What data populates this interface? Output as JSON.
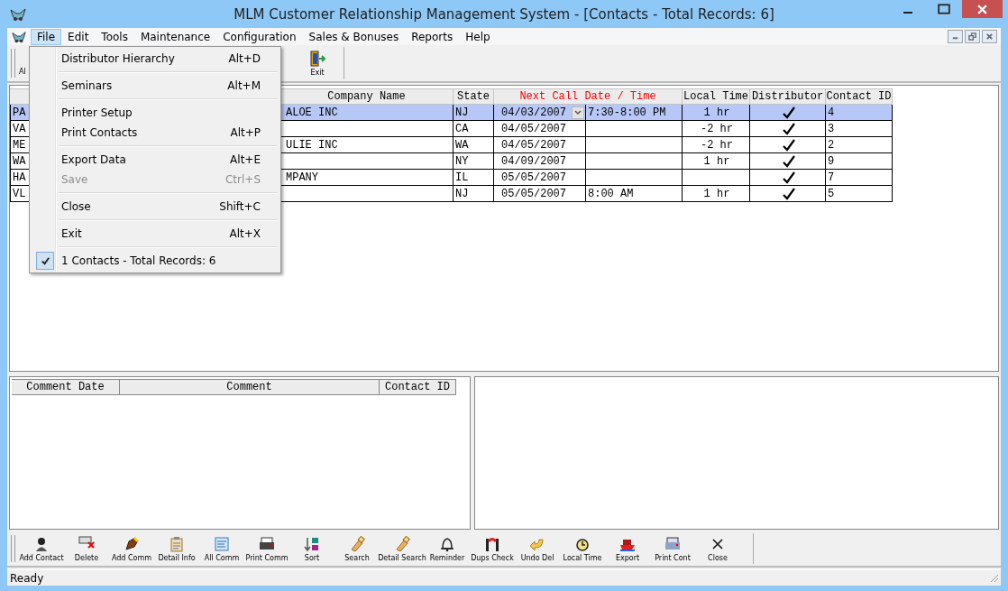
{
  "window": {
    "title": "MLM Customer Relationship Management System - [Contacts - Total Records: 6]"
  },
  "menu_bar": [
    {
      "label": "File",
      "selected": true
    },
    {
      "label": "Edit",
      "selected": false
    },
    {
      "label": "Tools",
      "selected": false
    },
    {
      "label": "Maintenance",
      "selected": false
    },
    {
      "label": "Configuration",
      "selected": false
    },
    {
      "label": "Sales & Bonuses",
      "selected": false
    },
    {
      "label": "Reports",
      "selected": false
    },
    {
      "label": "Help",
      "selected": false
    }
  ],
  "top_toolbar": [
    {
      "label": "Al"
    },
    {
      "label": "Exit"
    }
  ],
  "file_menu": [
    [
      {
        "label": "Distributor Hierarchy",
        "shortcut": "Alt+D",
        "disabled": false,
        "checked": false
      }
    ],
    [
      {
        "label": "Seminars",
        "shortcut": "Alt+M",
        "disabled": false,
        "checked": false
      }
    ],
    [
      {
        "label": "Printer Setup",
        "disabled": false,
        "checked": false
      },
      {
        "label": "Print Contacts",
        "shortcut": "Alt+P",
        "disabled": false,
        "checked": false
      }
    ],
    [
      {
        "label": "Export Data",
        "shortcut": "Alt+E",
        "disabled": false,
        "checked": false
      },
      {
        "label": "Save",
        "shortcut": "Ctrl+S",
        "disabled": true,
        "checked": false
      }
    ],
    [
      {
        "label": "Close",
        "shortcut": "Shift+C",
        "disabled": false,
        "checked": false
      }
    ],
    [
      {
        "label": "Exit",
        "shortcut": "Alt+X",
        "disabled": false,
        "checked": false
      }
    ],
    [
      {
        "label": "1 Contacts - Total Records: 6",
        "disabled": false,
        "checked": true
      }
    ]
  ],
  "contacts": {
    "columns": [
      {
        "label": "Company Name",
        "color": "#000000"
      },
      {
        "label": "State",
        "color": "#000000"
      },
      {
        "label": "Next Call Date / Time",
        "color": "#ff0000"
      },
      {
        "label": "Local Time",
        "color": "#000000"
      },
      {
        "label": "Distributor",
        "color": "#000000"
      },
      {
        "label": "Contact ID",
        "color": "#000000"
      }
    ],
    "rows": [
      {
        "column_1": "PA",
        "company": "ALOE INC",
        "state": "NJ",
        "date": "04/03/2007",
        "time": "7:30-8:00 PM",
        "local_time": "1 hr",
        "distributor": true,
        "contact_id": "4",
        "selected": true
      },
      {
        "column_1": "VA",
        "company": "",
        "state": "CA",
        "date": "04/05/2007",
        "time": "",
        "local_time": "-2 hr",
        "distributor": true,
        "contact_id": "3",
        "selected": false
      },
      {
        "column_1": "ME",
        "company": "ULIE INC",
        "state": "WA",
        "date": "04/05/2007",
        "time": "",
        "local_time": "-2 hr",
        "distributor": true,
        "contact_id": "2",
        "selected": false
      },
      {
        "column_1": "WA",
        "company": "",
        "state": "NY",
        "date": "04/09/2007",
        "time": "",
        "local_time": "1 hr",
        "distributor": true,
        "contact_id": "9",
        "selected": false
      },
      {
        "column_1": "HA",
        "company": "MPANY",
        "state": "IL",
        "date": "05/05/2007",
        "time": "",
        "local_time": "",
        "distributor": true,
        "contact_id": "7",
        "selected": false
      },
      {
        "column_1": "VL",
        "company": "",
        "state": "NJ",
        "date": "05/05/2007",
        "time": "8:00 AM",
        "local_time": "1 hr",
        "distributor": true,
        "contact_id": "5",
        "selected": false
      }
    ]
  },
  "comments": {
    "columns": [
      "Comment Date",
      "Comment",
      "Contact ID"
    ]
  },
  "bottom_toolbar": [
    {
      "label": "Add Contact"
    },
    {
      "label": "Delete"
    },
    {
      "label": "Add Comm"
    },
    {
      "label": "Detail Info"
    },
    {
      "label": "All Comm"
    },
    {
      "label": "Print Comm"
    },
    {
      "label": "Sort"
    },
    {
      "label": "Search"
    },
    {
      "label": "Detail Search"
    },
    {
      "label": "Reminder"
    },
    {
      "label": "Dups Check"
    },
    {
      "label": "Undo Del"
    },
    {
      "label": "Local Time"
    },
    {
      "label": "Export"
    },
    {
      "label": "Print Cont"
    },
    {
      "label": "Close"
    }
  ],
  "status_bar": {
    "text": "Ready"
  }
}
